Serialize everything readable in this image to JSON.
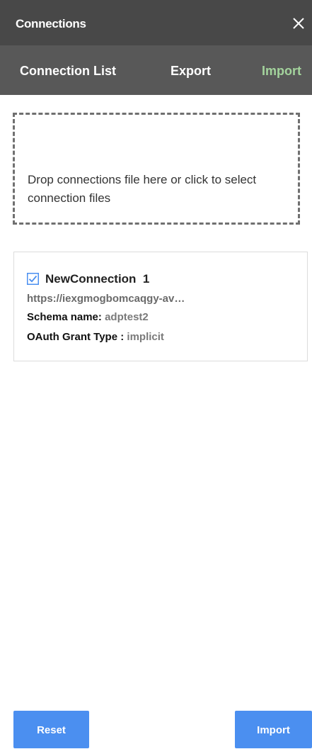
{
  "header": {
    "title": "Connections",
    "close_icon": "close-icon"
  },
  "tabs": [
    {
      "label": "Connection List",
      "active": false
    },
    {
      "label": "Export",
      "active": false
    },
    {
      "label": "Import",
      "active": true
    }
  ],
  "dropzone": {
    "text": "Drop connections file here or click to select connection files"
  },
  "connection": {
    "checked": true,
    "name": "NewConnection  1",
    "url": "https://iexgmogbomcaqgy-av…",
    "schema_label": "Schema name:",
    "schema_value": "adptest2",
    "oauth_label": "OAuth Grant Type :",
    "oauth_value": "implicit"
  },
  "footer": {
    "reset_label": "Reset",
    "import_label": "Import"
  },
  "colors": {
    "title_bar": "#484848",
    "tab_bar": "#585858",
    "active_tab": "#a3d39c",
    "button": "#4b8ff0",
    "checkbox": "#4b8ff0"
  }
}
